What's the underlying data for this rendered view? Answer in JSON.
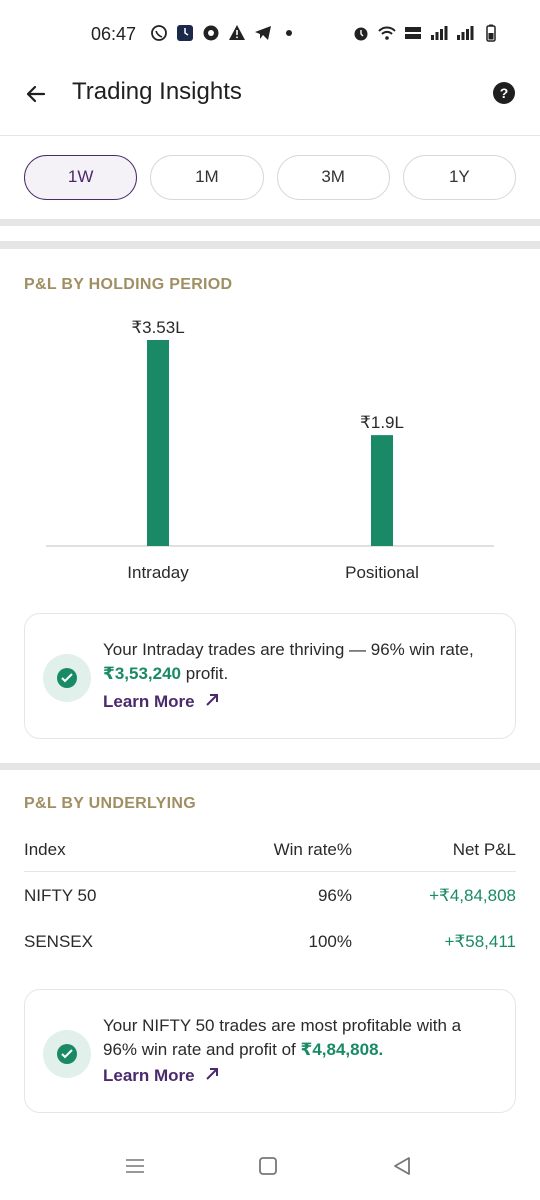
{
  "status_bar": {
    "time": "06:47",
    "left_icons": [
      "whatsapp-icon",
      "clock-app-icon",
      "chrome-icon",
      "warning-icon",
      "telegram-icon",
      "dot-icon"
    ],
    "right_icons": [
      "alarm-icon",
      "wifi-icon",
      "volte-icon",
      "signal-icon",
      "signal-icon",
      "battery-icon"
    ]
  },
  "header": {
    "title": "Trading Insights",
    "help_label": "?"
  },
  "tabs": [
    {
      "label": "1W",
      "active": true
    },
    {
      "label": "1M",
      "active": false
    },
    {
      "label": "3M",
      "active": false
    },
    {
      "label": "1Y",
      "active": false
    }
  ],
  "holding_period": {
    "title": "P&L BY HOLDING PERIOD",
    "insight": {
      "text_before": "Your Intraday trades are thriving — 96% win rate, ",
      "amount": "₹3,53,240",
      "text_after": " profit.",
      "learn_more": "Learn More"
    }
  },
  "chart_data": {
    "type": "bar",
    "categories": [
      "Intraday",
      "Positional"
    ],
    "values": [
      3.53,
      1.9
    ],
    "data_labels": [
      "₹3.53L",
      "₹1.9L"
    ],
    "unit": "lakh ₹",
    "ylim": [
      0,
      3.53
    ],
    "bar_color": "#1a8a66",
    "grid": false,
    "title": "",
    "xlabel": "",
    "ylabel": ""
  },
  "underlying": {
    "title": "P&L BY UNDERLYING",
    "columns": [
      "Index",
      "Win rate%",
      "Net P&L"
    ],
    "rows": [
      {
        "index": "NIFTY 50",
        "win_rate": "96%",
        "net_pl": "+₹4,84,808"
      },
      {
        "index": "SENSEX",
        "win_rate": "100%",
        "net_pl": "+₹58,411"
      }
    ],
    "insight": {
      "text_before": "Your NIFTY 50 trades are most profitable with a 96% win rate and profit of ",
      "amount": "₹4,84,808.",
      "text_after": "",
      "learn_more": "Learn More"
    }
  },
  "colors": {
    "accent": "#4b2a6b",
    "positive": "#1a8a66",
    "section_heading": "#a08f63"
  }
}
